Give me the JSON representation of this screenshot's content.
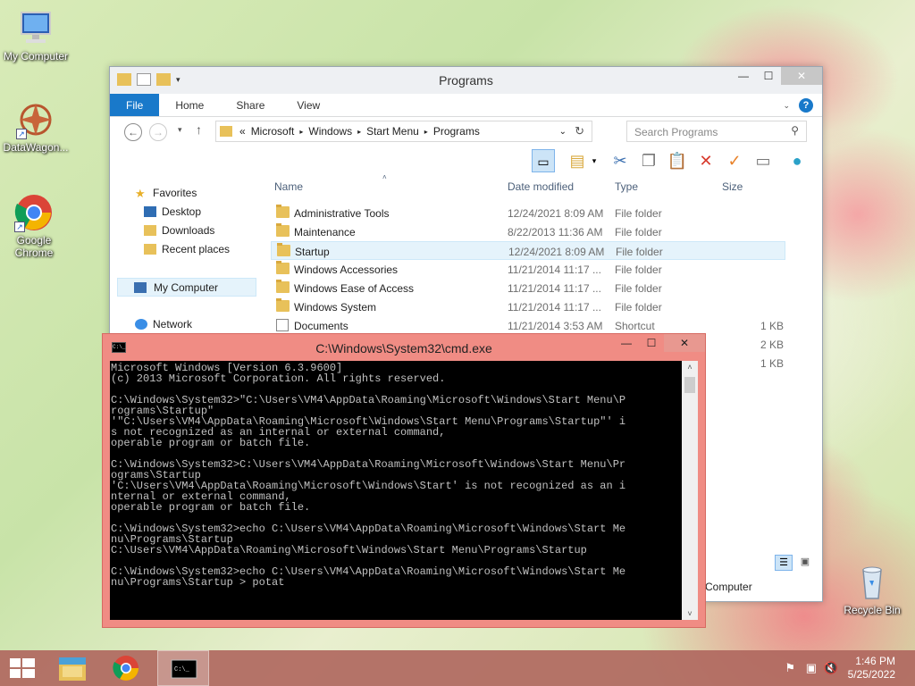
{
  "desktop": {
    "icons": [
      {
        "label": "My Computer"
      },
      {
        "label": "DataWagon..."
      },
      {
        "label": "Google Chrome"
      },
      {
        "label": "Recycle Bin"
      }
    ]
  },
  "explorer": {
    "title": "Programs",
    "tabs": [
      "File",
      "Home",
      "Share",
      "View"
    ],
    "address": {
      "prefix": "«",
      "crumbs": [
        "Microsoft",
        "Windows",
        "Start Menu",
        "Programs"
      ]
    },
    "search_placeholder": "Search Programs",
    "nav": {
      "favorites": "Favorites",
      "desktop": "Desktop",
      "downloads": "Downloads",
      "recent": "Recent places",
      "mycomputer": "My Computer",
      "network": "Network"
    },
    "columns": {
      "name": "Name",
      "date": "Date modified",
      "type": "Type",
      "size": "Size"
    },
    "rows": [
      {
        "name": "Administrative Tools",
        "date": "12/24/2021 8:09 AM",
        "type": "File folder",
        "size": ""
      },
      {
        "name": "Maintenance",
        "date": "8/22/2013 11:36 AM",
        "type": "File folder",
        "size": ""
      },
      {
        "name": "Startup",
        "date": "12/24/2021 8:09 AM",
        "type": "File folder",
        "size": ""
      },
      {
        "name": "Windows Accessories",
        "date": "11/21/2014 11:17 ...",
        "type": "File folder",
        "size": ""
      },
      {
        "name": "Windows Ease of Access",
        "date": "11/21/2014 11:17 ...",
        "type": "File folder",
        "size": ""
      },
      {
        "name": "Windows System",
        "date": "11/21/2014 11:17 ...",
        "type": "File folder",
        "size": ""
      },
      {
        "name": "Documents",
        "date": "11/21/2014 3:53 AM",
        "type": "Shortcut",
        "size": "1 KB"
      }
    ],
    "hidden_sizes": [
      "2 KB",
      "1 KB"
    ],
    "status_partial": "Computer"
  },
  "cmd": {
    "title": "C:\\Windows\\System32\\cmd.exe",
    "lines": [
      "Microsoft Windows [Version 6.3.9600]",
      "(c) 2013 Microsoft Corporation. All rights reserved.",
      "",
      "C:\\Windows\\System32>\"C:\\Users\\VM4\\AppData\\Roaming\\Microsoft\\Windows\\Start Menu\\P",
      "rograms\\Startup\"",
      "'\"C:\\Users\\VM4\\AppData\\Roaming\\Microsoft\\Windows\\Start Menu\\Programs\\Startup\"' i",
      "s not recognized as an internal or external command,",
      "operable program or batch file.",
      "",
      "C:\\Windows\\System32>C:\\Users\\VM4\\AppData\\Roaming\\Microsoft\\Windows\\Start Menu\\Pr",
      "ograms\\Startup",
      "'C:\\Users\\VM4\\AppData\\Roaming\\Microsoft\\Windows\\Start' is not recognized as an i",
      "nternal or external command,",
      "operable program or batch file.",
      "",
      "C:\\Windows\\System32>echo C:\\Users\\VM4\\AppData\\Roaming\\Microsoft\\Windows\\Start Me",
      "nu\\Programs\\Startup",
      "C:\\Users\\VM4\\AppData\\Roaming\\Microsoft\\Windows\\Start Menu\\Programs\\Startup",
      "",
      "C:\\Windows\\System32>echo C:\\Users\\VM4\\AppData\\Roaming\\Microsoft\\Windows\\Start Me",
      "nu\\Programs\\Startup > potat"
    ]
  },
  "taskbar": {
    "time": "1:46 PM",
    "date": "5/25/2022"
  },
  "colors": {
    "file_tab": "#1979ca",
    "cmd_frame": "#f08c84",
    "taskbar": "#b06860",
    "selection": "#e5f3fb"
  }
}
